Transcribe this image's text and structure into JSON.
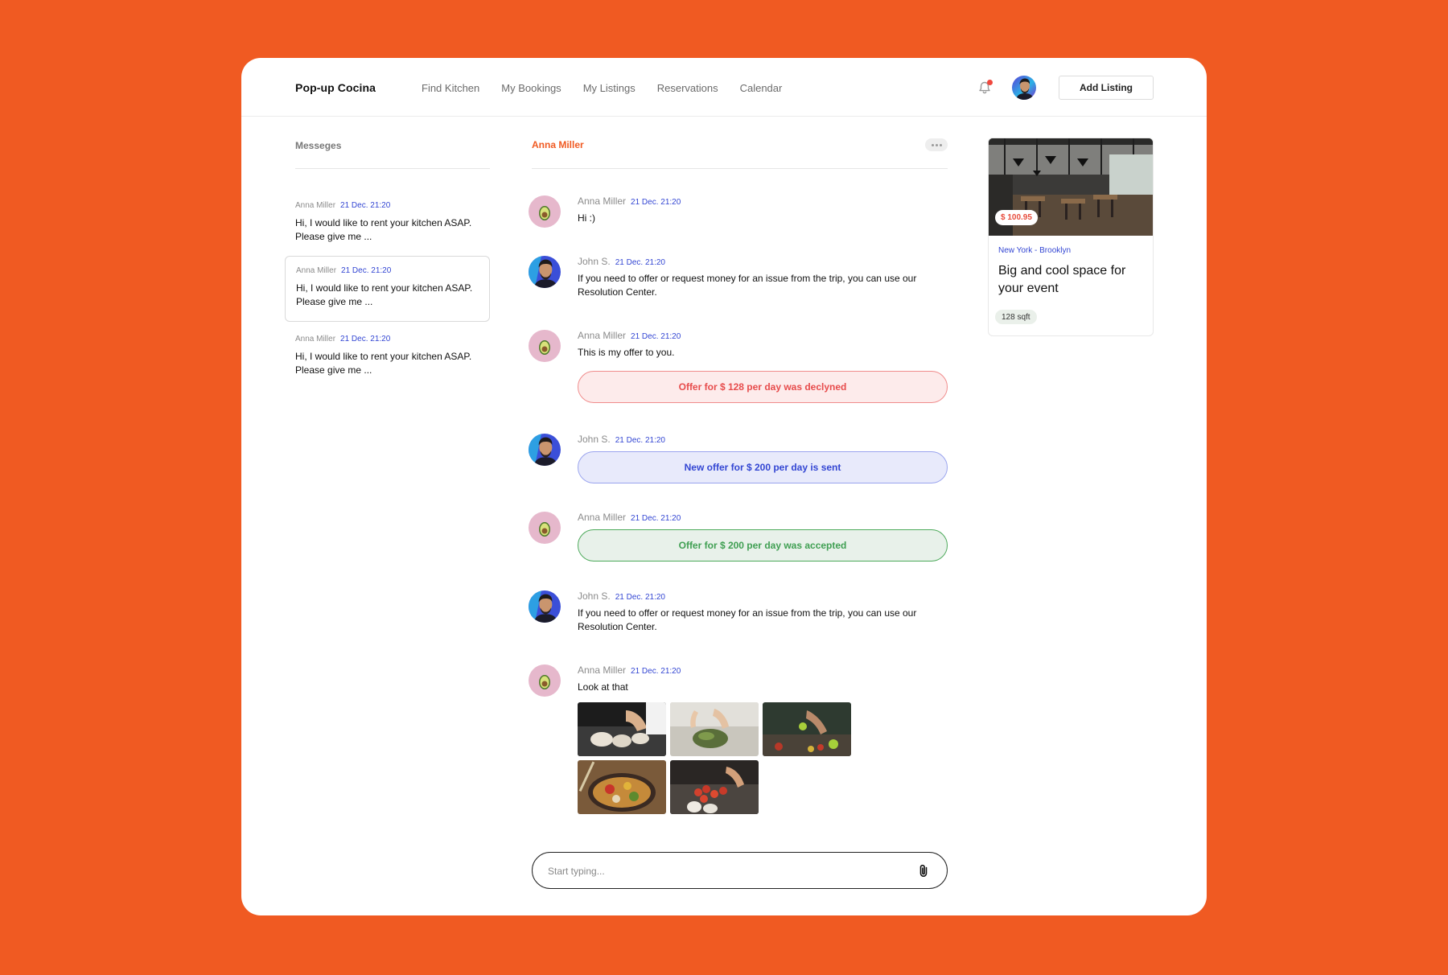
{
  "header": {
    "brand": "Pop-up Cocina",
    "nav": [
      "Find Kitchen",
      "My Bookings",
      "My Listings",
      "Reservations",
      "Calendar"
    ],
    "add_listing_label": "Add Listing"
  },
  "inbox": {
    "title": "Messeges",
    "threads": [
      {
        "name": "Anna Miller",
        "time": "21 Dec. 21:20",
        "preview": "Hi, I would like to rent your kitchen ASAP. Please give me ..."
      },
      {
        "name": "Anna Miller",
        "time": "21 Dec. 21:20",
        "preview": "Hi, I would like to rent your kitchen ASAP. Please give me ..."
      },
      {
        "name": "Anna Miller",
        "time": "21 Dec. 21:20",
        "preview": "Hi, I would like to rent your kitchen ASAP. Please give me ..."
      }
    ]
  },
  "chat": {
    "contact_name": "Anna Miller",
    "messages": [
      {
        "name": "Anna Miller",
        "time": "21 Dec. 21:20",
        "text": "Hi :)"
      },
      {
        "name": "John S.",
        "time": "21 Dec. 21:20",
        "text": "If you need to offer or request money for an issue from the trip, you can use our Resolution Center."
      },
      {
        "name": "Anna Miller",
        "time": "21 Dec. 21:20",
        "text": "This is my offer to you.",
        "status": "Offer for $ 128 per day was declyned"
      },
      {
        "name": "John S.",
        "time": "21 Dec. 21:20",
        "status": "New offer for $ 200 per day is sent"
      },
      {
        "name": "Anna Miller",
        "time": "21 Dec. 21:20",
        "status": "Offer for $ 200 per day was accepted"
      },
      {
        "name": "John S.",
        "time": "21 Dec. 21:20",
        "text": "If you need to offer or request money for an issue from the trip, you can use our Resolution Center."
      },
      {
        "name": "Anna Miller",
        "time": "21 Dec. 21:20",
        "text": "Look at that"
      }
    ],
    "composer_placeholder": "Start typing..."
  },
  "listing": {
    "price": "$ 100.95",
    "location": "New York - Brooklyn",
    "title": "Big and cool space for your event",
    "size": "128 sqft"
  },
  "colors": {
    "background": "#F05A22",
    "accent_blue": "#3346D3",
    "declined": "#E74C4C",
    "accepted": "#3F9F52"
  },
  "icons": [
    "bell-icon",
    "more-dots-icon",
    "paperclip-icon"
  ]
}
